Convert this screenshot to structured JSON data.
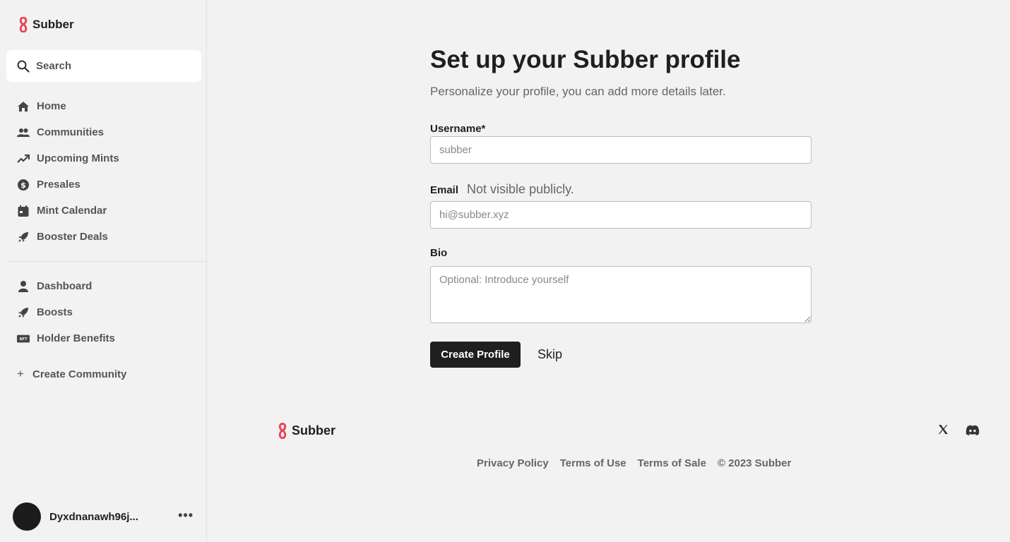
{
  "brand": {
    "name": "Subber",
    "accent": "#e8485a"
  },
  "search": {
    "label": "Search"
  },
  "nav_primary": [
    {
      "label": "Home",
      "icon": "home-icon"
    },
    {
      "label": "Communities",
      "icon": "people-icon"
    },
    {
      "label": "Upcoming Mints",
      "icon": "trending-up-icon"
    },
    {
      "label": "Presales",
      "icon": "dollar-icon"
    },
    {
      "label": "Mint Calendar",
      "icon": "calendar-icon"
    },
    {
      "label": "Booster Deals",
      "icon": "rocket-icon"
    }
  ],
  "nav_secondary": [
    {
      "label": "Dashboard",
      "icon": "person-icon"
    },
    {
      "label": "Boosts",
      "icon": "rocket-icon"
    },
    {
      "label": "Holder Benefits",
      "icon": "nft-icon"
    }
  ],
  "create_community": {
    "label": "Create Community"
  },
  "user": {
    "name": "Dyxdnanawh96j...",
    "more": "•••"
  },
  "form": {
    "title": "Set up your Subber profile",
    "subtitle": "Personalize your profile, you can add more details later.",
    "username": {
      "label": "Username*",
      "placeholder": "subber"
    },
    "email": {
      "label": "Email",
      "hint": "Not visible publicly.",
      "placeholder": "hi@subber.xyz"
    },
    "bio": {
      "label": "Bio",
      "placeholder": "Optional: Introduce yourself"
    },
    "submit_label": "Create Profile",
    "skip_label": "Skip"
  },
  "footer": {
    "brand": "Subber",
    "links": [
      "Privacy Policy",
      "Terms of Use",
      "Terms of Sale"
    ],
    "copyright": "© 2023 Subber",
    "social_icons": [
      "x-icon",
      "discord-icon"
    ]
  }
}
